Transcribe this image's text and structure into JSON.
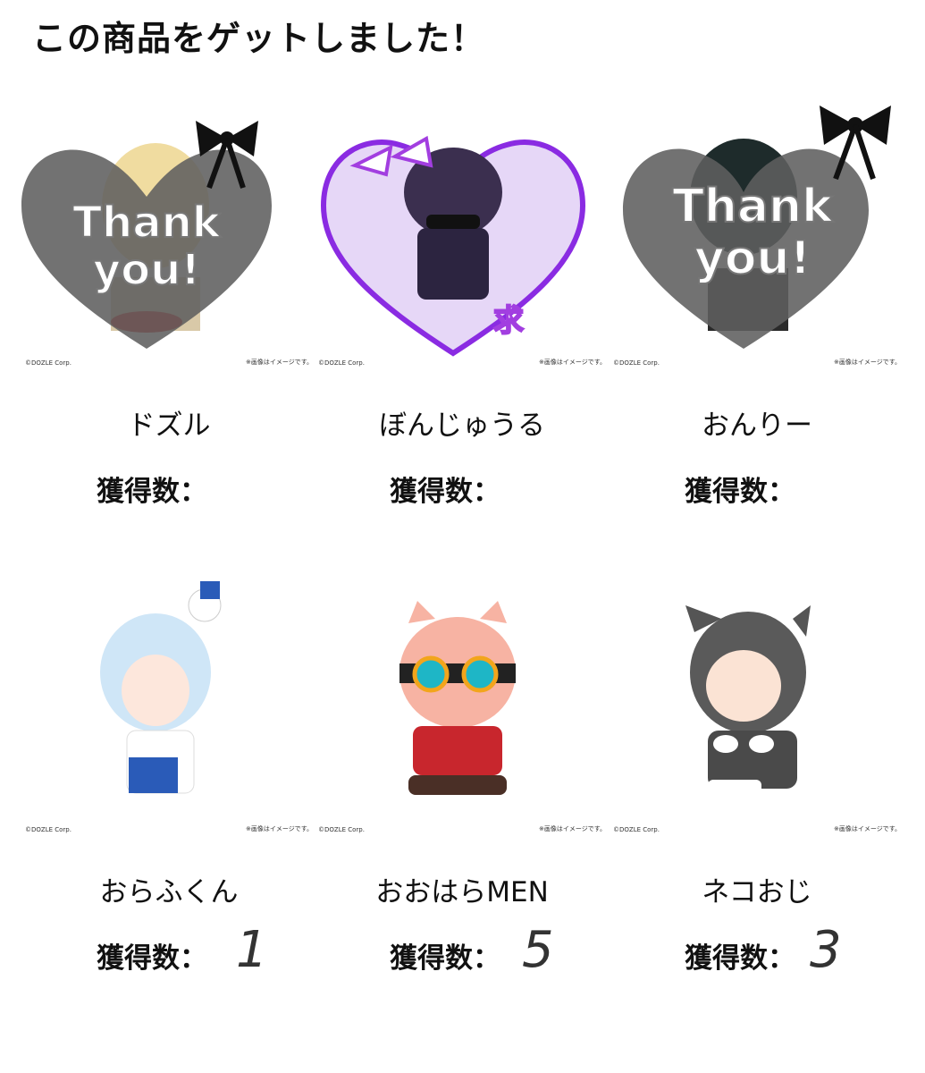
{
  "page": {
    "title": "この商品をゲットしました！"
  },
  "credits": {
    "left": "©DOZLE Corp.",
    "right": "※画像はイメージです。"
  },
  "count_label": "獲得数：",
  "overlay": {
    "line1": "Thank",
    "line2": "you!",
    "kanji": "求"
  },
  "cards": [
    {
      "name": "ドズル",
      "count": ""
    },
    {
      "name": "ぼんじゅうる",
      "count": ""
    },
    {
      "name": "おんりー",
      "count": ""
    },
    {
      "name": "おらふくん",
      "count": "1"
    },
    {
      "name": "おおはらMEN",
      "count": "5"
    },
    {
      "name": "ネコおじ",
      "count": "3"
    }
  ],
  "colors": {
    "heart_gray": "#5f5f5f",
    "heart_purple": "#8a2be2",
    "heart_purple_fill": "#e6d7f7"
  }
}
